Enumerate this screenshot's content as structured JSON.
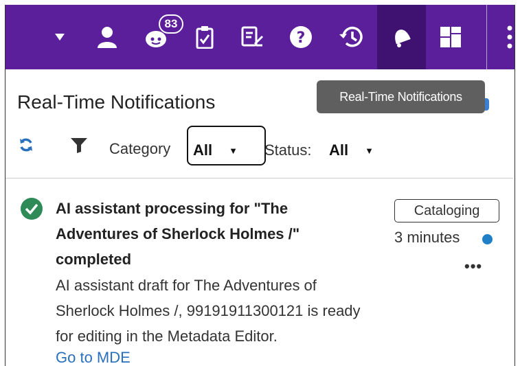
{
  "topbar": {
    "badge_count": "83",
    "icons": [
      "chevron-down-icon",
      "user-icon",
      "chat-bot-icon",
      "tasks-clipboard-icon",
      "edit-document-icon",
      "help-icon",
      "history-icon",
      "notifications-bell-icon",
      "dashboard-layout-icon",
      "more-vertical-icon"
    ],
    "accent_color": "#5b1f9c"
  },
  "panel": {
    "title": "Real-Time Notifications",
    "tooltip": "Real-Time Notifications"
  },
  "filters": {
    "category_label": "Category",
    "category_value": "All",
    "status_label": "Status:",
    "status_value": "All",
    "caret": "▼"
  },
  "notification": {
    "title": "AI assistant processing for \"The Adventures of Sherlock Holmes /\" completed",
    "body": "AI assistant draft for The Adventures of Sherlock Holmes /, 99191911300121 is ready for editing in the Metadata Editor.",
    "link": "Go to MDE",
    "category": "Cataloging",
    "time": "3 minutes",
    "more": "•••",
    "status_icon": "check-circle-icon",
    "unread_color": "#1f7fc7"
  }
}
